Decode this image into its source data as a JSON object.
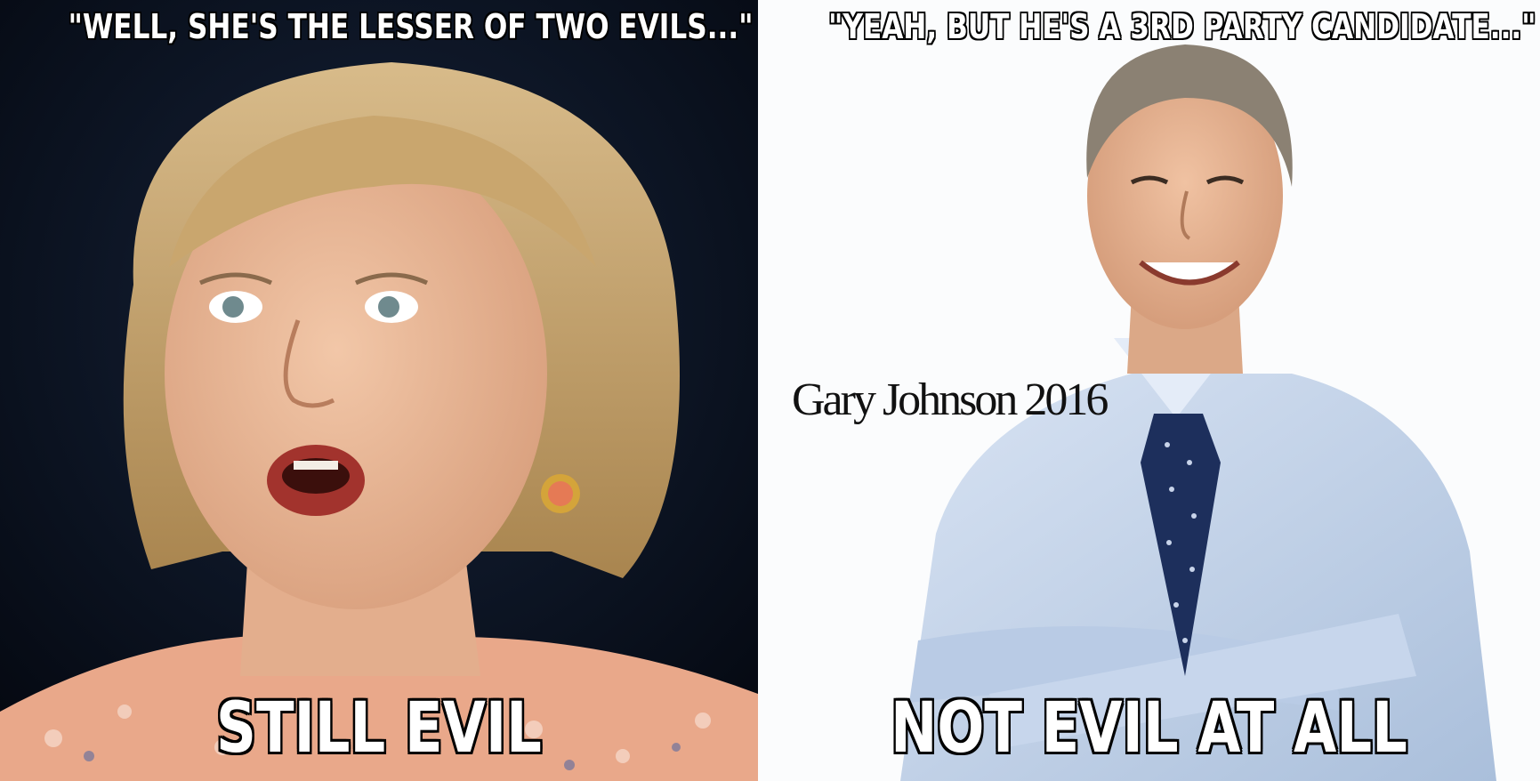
{
  "left_panel": {
    "top_caption": "\"WELL, SHE'S THE LESSER OF TWO EVILS...\"",
    "bottom_caption": "STILL EVIL"
  },
  "right_panel": {
    "top_caption": "\"YEAH, BUT HE'S A 3RD PARTY CANDIDATE...\"",
    "bottom_caption": "NOT EVIL AT ALL",
    "overlay_caption": "Gary Johnson 2016"
  },
  "colors": {
    "left_background": "#050a14",
    "right_background": "#fbfcfd",
    "caption_fill": "#ffffff",
    "caption_outline": "#000000"
  }
}
